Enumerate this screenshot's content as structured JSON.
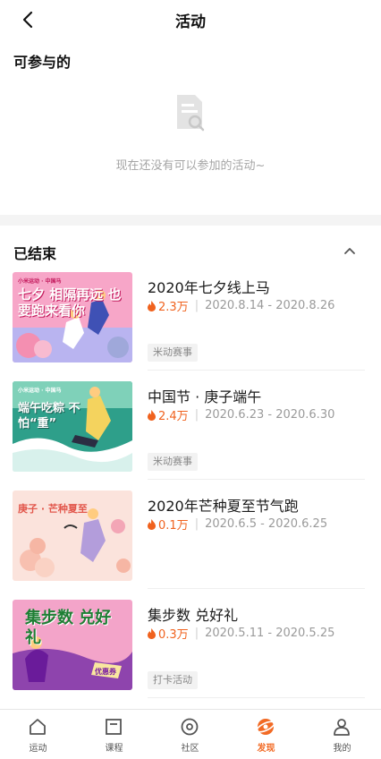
{
  "header": {
    "title": "活动"
  },
  "available": {
    "section_title": "可参与的",
    "empty_text": "现在还没有可以参加的活动~"
  },
  "ended": {
    "section_title": "已结束",
    "items": [
      {
        "name": "2020年七夕线上马",
        "heat": "2.3万",
        "dates": "2020.8.14 - 2020.8.26",
        "tag": "米动赛事",
        "banner_title": "七夕 相隔再远 也要跑来看你",
        "banner_logo": "小米运动 · 中国马"
      },
      {
        "name": "中国节 · 庚子端午",
        "heat": "2.4万",
        "dates": "2020.6.23 - 2020.6.30",
        "tag": "米动赛事",
        "banner_title": "端午吃粽 不怕“重”",
        "banner_logo": "小米运动 · 中国马"
      },
      {
        "name": "2020年芒种夏至节气跑",
        "heat": "0.1万",
        "dates": "2020.6.5 - 2020.6.25",
        "tag": "",
        "banner_title": "庚子 · 芒种夏至"
      },
      {
        "name": "集步数 兑好礼",
        "heat": "0.3万",
        "dates": "2020.5.11 - 2020.5.25",
        "tag": "打卡活动",
        "banner_title": "集步数 兑好礼",
        "banner_badge": "优惠券"
      }
    ]
  },
  "tabbar": {
    "tabs": [
      {
        "label": "运动",
        "icon": "home-icon"
      },
      {
        "label": "课程",
        "icon": "course-icon"
      },
      {
        "label": "社区",
        "icon": "community-icon"
      },
      {
        "label": "发现",
        "icon": "discover-icon",
        "active": true
      },
      {
        "label": "我的",
        "icon": "profile-icon"
      }
    ]
  },
  "colors": {
    "accent": "#f26a24",
    "heat": "#f0621e",
    "divider": "#f4f4f4"
  }
}
